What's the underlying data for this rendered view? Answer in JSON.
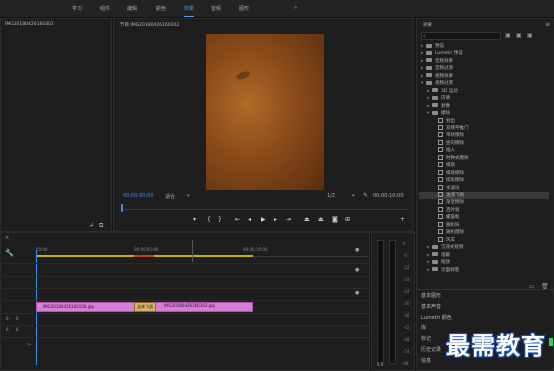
{
  "workspace_tabs": [
    "学习",
    "组件",
    "编辑",
    "颜色",
    "效果",
    "音频",
    "图形",
    "»"
  ],
  "active_tab_index": 4,
  "source": {
    "title": "IMG20180426160302"
  },
  "program": {
    "title": "节目 IMG20180426160302",
    "timecode_in": "00:00:00:00",
    "fit": "适合",
    "ratio": "1/2",
    "timecode_out": "00:00:10:00"
  },
  "transport_icons": [
    "marker-icon",
    "in-point-icon",
    "out-point-icon",
    "go-to-in-icon",
    "step-back-icon",
    "play-icon",
    "step-forward-icon",
    "go-to-out-icon",
    "lift-icon",
    "extract-icon",
    "export-frame-icon",
    "button-editor-icon",
    "add-icon"
  ],
  "effects": {
    "title": "效果",
    "tree": [
      {
        "label": "预设",
        "level": 0,
        "type": "folder"
      },
      {
        "label": "Lumetri 预设",
        "level": 0,
        "type": "folder"
      },
      {
        "label": "音频效果",
        "level": 0,
        "type": "folder"
      },
      {
        "label": "音频过渡",
        "level": 0,
        "type": "folder"
      },
      {
        "label": "视频效果",
        "level": 0,
        "type": "folder"
      },
      {
        "label": "视频过渡",
        "level": 0,
        "type": "folder",
        "open": true
      },
      {
        "label": "3D 运动",
        "level": 1,
        "type": "folder"
      },
      {
        "label": "内滑",
        "level": 1,
        "type": "folder"
      },
      {
        "label": "划像",
        "level": 1,
        "type": "folder"
      },
      {
        "label": "擦除",
        "level": 1,
        "type": "folder",
        "open": true
      },
      {
        "label": "划出",
        "level": 2,
        "type": "effect"
      },
      {
        "label": "双侧平推门",
        "level": 2,
        "type": "effect"
      },
      {
        "label": "带状擦除",
        "level": 2,
        "type": "effect"
      },
      {
        "label": "径向擦除",
        "level": 2,
        "type": "effect"
      },
      {
        "label": "插入",
        "level": 2,
        "type": "effect"
      },
      {
        "label": "时钟式擦除",
        "level": 2,
        "type": "effect"
      },
      {
        "label": "棋盘",
        "level": 2,
        "type": "effect"
      },
      {
        "label": "棋盘擦除",
        "level": 2,
        "type": "effect"
      },
      {
        "label": "楔形擦除",
        "level": 2,
        "type": "effect"
      },
      {
        "label": "水波块",
        "level": 2,
        "type": "effect"
      },
      {
        "label": "油漆飞溅",
        "level": 2,
        "type": "effect",
        "selected": true
      },
      {
        "label": "渐变擦除",
        "level": 2,
        "type": "effect"
      },
      {
        "label": "百叶窗",
        "level": 2,
        "type": "effect"
      },
      {
        "label": "螺旋框",
        "level": 2,
        "type": "effect"
      },
      {
        "label": "随机块",
        "level": 2,
        "type": "effect"
      },
      {
        "label": "随机擦除",
        "level": 2,
        "type": "effect"
      },
      {
        "label": "风车",
        "level": 2,
        "type": "effect"
      },
      {
        "label": "沉浸式视频",
        "level": 1,
        "type": "folder"
      },
      {
        "label": "溶解",
        "level": 1,
        "type": "folder"
      },
      {
        "label": "缩放",
        "level": 1,
        "type": "folder"
      },
      {
        "label": "页面剥落",
        "level": 1,
        "type": "folder"
      }
    ],
    "bottom_panels": [
      "基本图形",
      "基本声音",
      "Lumetri 颜色",
      "库",
      "标记",
      "历史记录",
      "信息"
    ]
  },
  "timeline": {
    "ruler": [
      "00:00",
      "00:00:05:00",
      "00:00:10:00"
    ],
    "clips": [
      {
        "label": "IMG20180426160156.jpg"
      },
      {
        "label": "油漆飞溅"
      },
      {
        "label": "IMG20180426160302.jpg"
      }
    ],
    "track_labels": [
      "6",
      "6",
      "6",
      "6"
    ]
  },
  "meter_scale": [
    "0",
    "-6",
    "-12",
    "-18",
    "-24",
    "-30",
    "-36",
    "-42",
    "-48",
    "-54",
    "dB"
  ],
  "watermark": "最需教育"
}
